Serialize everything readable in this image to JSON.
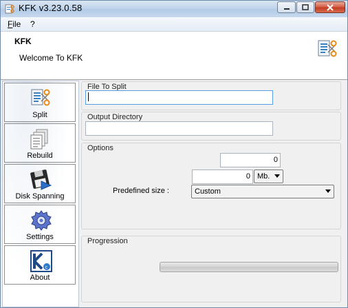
{
  "window": {
    "title": "KFK v3.23.0.58"
  },
  "menu": {
    "file_underlined": "F",
    "file_rest": "ile",
    "help": "?"
  },
  "header": {
    "title": "KFK",
    "welcome": "Welcome To KFK"
  },
  "sidebar": {
    "items": [
      {
        "label": "Split",
        "icon": "split-icon"
      },
      {
        "label": "Rebuild",
        "icon": "rebuild-icon"
      },
      {
        "label": "Disk Spanning",
        "icon": "disk-spanning-icon"
      },
      {
        "label": "Settings",
        "icon": "settings-icon"
      },
      {
        "label": "About",
        "icon": "about-icon"
      }
    ]
  },
  "file_to_split": {
    "title": "File To Split",
    "value": ""
  },
  "output_directory": {
    "title": "Output Directory",
    "value": ""
  },
  "options": {
    "title": "Options",
    "parts_value": "0",
    "size_value": "0",
    "unit": "Mb.",
    "predefined_label": "Predefined size :",
    "predefined_value": "Custom"
  },
  "progression": {
    "title": "Progression",
    "progress": 0
  },
  "colors": {
    "accent": "#569de5",
    "close_button": "#c23f23",
    "progress_green": "#38c038"
  }
}
